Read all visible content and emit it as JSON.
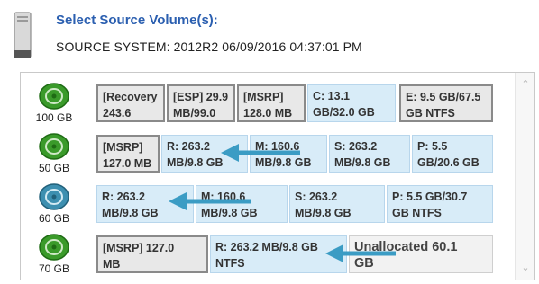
{
  "header": {
    "title": "Select Source Volume(s):",
    "source_system": "SOURCE SYSTEM:  2012R2 06/09/2016 04:37:01 PM"
  },
  "disks": [
    {
      "size": "100 GB",
      "icon_color": "#3a9a2a",
      "partitions": [
        {
          "line1": "[Recovery",
          "line2": "243.6"
        },
        {
          "line1": "[ESP] 29.9",
          "line2": "MB/99.0"
        },
        {
          "line1": "[MSRP]",
          "line2": "128.0 MB"
        },
        {
          "line1": "C: 13.1",
          "line2": "GB/32.0 GB"
        },
        {
          "line1": "E: 9.5 GB/67.5",
          "line2": "GB NTFS"
        }
      ]
    },
    {
      "size": "50 GB",
      "icon_color": "#3a9a2a",
      "partitions": [
        {
          "line1": "[MSRP]",
          "line2": "127.0 MB"
        },
        {
          "line1": "R: 263.2",
          "line2": "MB/9.8 GB"
        },
        {
          "line1": "M: 160.6",
          "line2": "MB/9.8 GB"
        },
        {
          "line1": "S: 263.2",
          "line2": "MB/9.8 GB"
        },
        {
          "line1": "P: 5.5",
          "line2": "GB/20.6 GB"
        }
      ]
    },
    {
      "size": "60 GB",
      "icon_color": "#3d8fb0",
      "partitions": [
        {
          "line1": "R: 263.2",
          "line2": "MB/9.8 GB"
        },
        {
          "line1": "M: 160.6",
          "line2": "MB/9.8 GB"
        },
        {
          "line1": "S: 263.2",
          "line2": "MB/9.8 GB"
        },
        {
          "line1": "P: 5.5 GB/30.7",
          "line2": "GB NTFS"
        }
      ]
    },
    {
      "size": "70 GB",
      "icon_color": "#3a9a2a",
      "partitions": [
        {
          "line1": "[MSRP] 127.0",
          "line2": "MB"
        },
        {
          "line1": "R: 263.2 MB/9.8 GB",
          "line2": "NTFS"
        },
        {
          "line1": "Unallocated 60.1",
          "line2": "GB"
        }
      ]
    }
  ],
  "colors": {
    "title": "#2b5fb0",
    "partition_blue": "#d8ecf8",
    "partition_grey": "#e8e8e8",
    "arrow": "#3b9cc4"
  },
  "icons": [
    "server-icon",
    "disk-icon",
    "arrow-icon",
    "scroll-up-icon",
    "scroll-down-icon"
  ]
}
